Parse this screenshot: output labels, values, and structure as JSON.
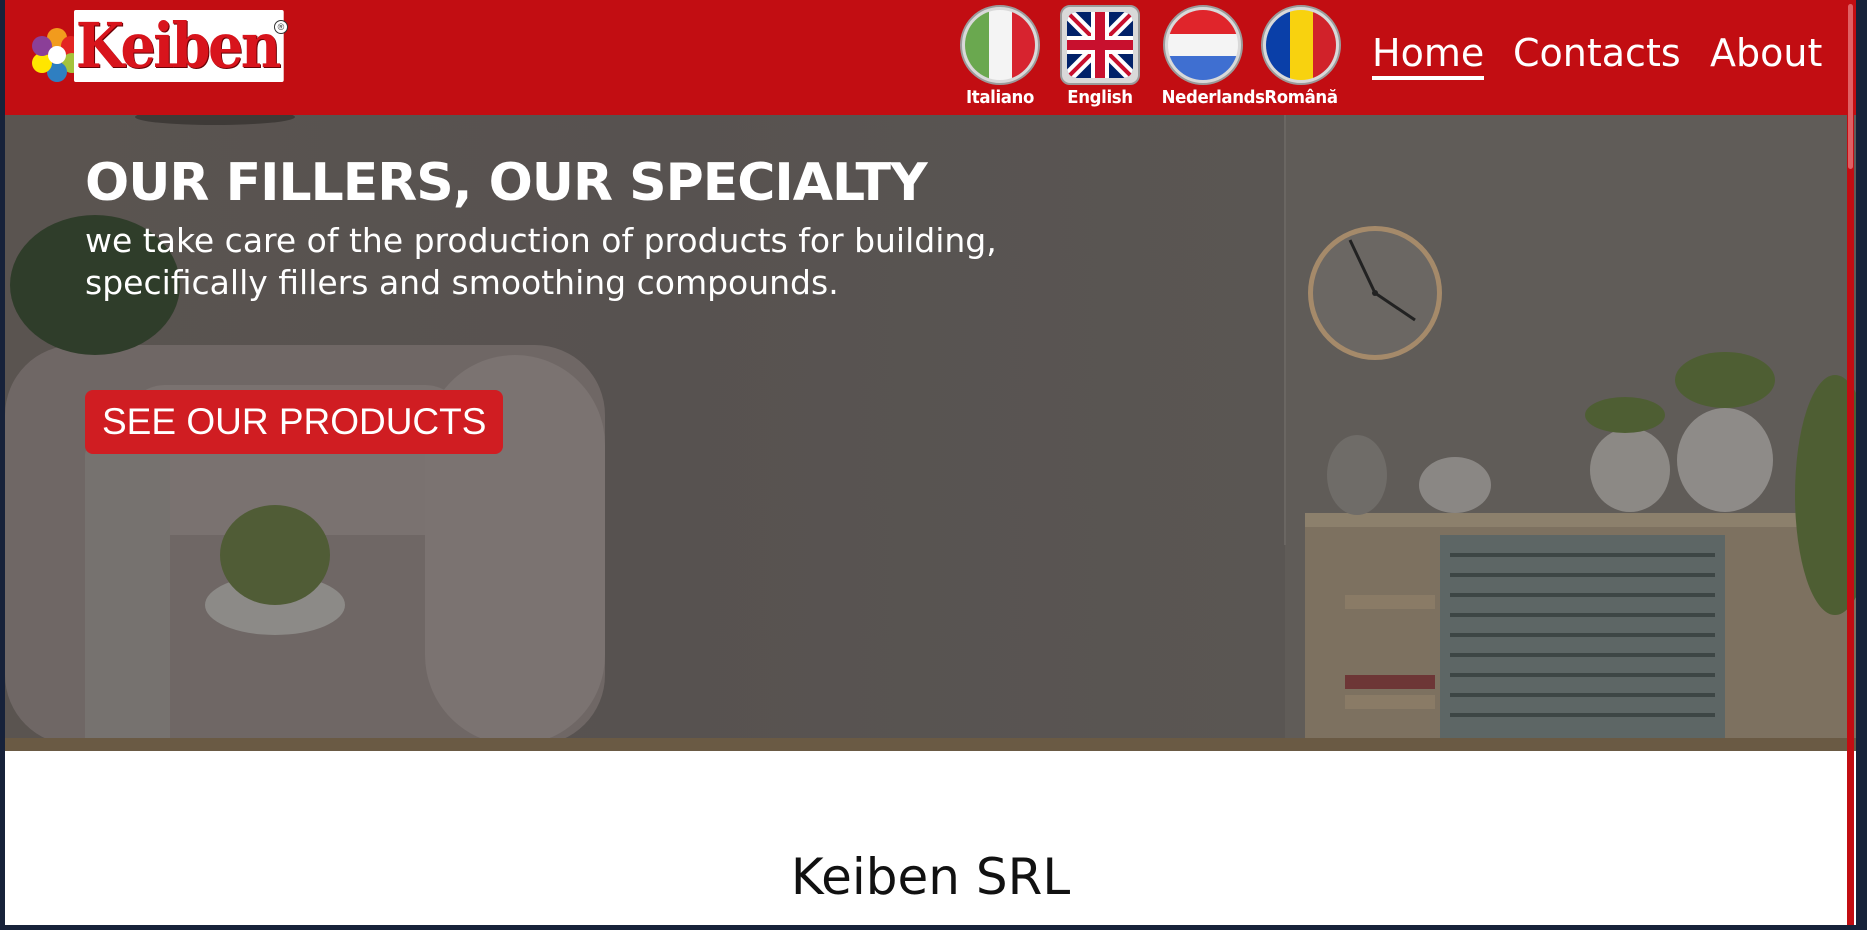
{
  "brand": {
    "name": "Keiben",
    "registered_mark": "®"
  },
  "languages": [
    {
      "label": "Italiano",
      "icon": "italy-flag-icon",
      "active": false
    },
    {
      "label": "English",
      "icon": "uk-flag-icon",
      "active": true
    },
    {
      "label": "Nederlands",
      "icon": "netherlands-flag-icon",
      "active": false
    },
    {
      "label": "Română",
      "icon": "romania-flag-icon",
      "active": false
    }
  ],
  "nav": [
    {
      "label": "Home",
      "active": true
    },
    {
      "label": "Contacts",
      "active": false
    },
    {
      "label": "About",
      "active": false
    }
  ],
  "hero": {
    "title": "OUR FILLERS, OUR SPECIALTY",
    "subtitle": "we take care of the production of products for building, specifically fillers and smoothing compounds.",
    "cta_label": "SEE OUR PRODUCTS"
  },
  "section": {
    "heading": "Keiben SRL"
  },
  "colors": {
    "brand_red": "#c20d12",
    "button_red": "#d01d22",
    "text_white": "#ffffff"
  }
}
